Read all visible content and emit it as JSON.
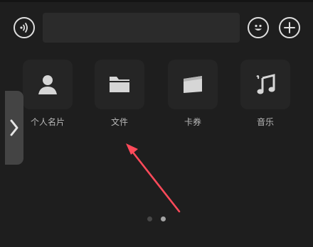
{
  "input_bar": {
    "voice_icon": "voice-wave-icon",
    "text_value": "",
    "emoji_icon": "smiley-icon",
    "plus_icon": "plus-icon"
  },
  "apps": [
    {
      "label": "个人名片",
      "icon": "person-icon"
    },
    {
      "label": "文件",
      "icon": "folder-icon"
    },
    {
      "label": "卡券",
      "icon": "ticket-icon"
    },
    {
      "label": "音乐",
      "icon": "music-note-icon"
    }
  ],
  "pager": {
    "pages": 2,
    "current": 2
  },
  "colors": {
    "background": "#1e1e1e",
    "tile": "#252525",
    "icon": "#d6d6d6",
    "label": "#b8b8b8",
    "annotation_arrow": "#ff4a5a"
  }
}
